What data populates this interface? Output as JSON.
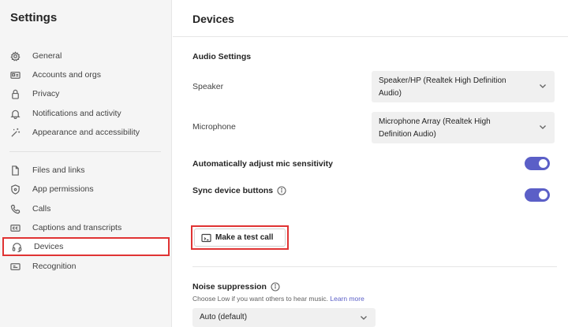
{
  "sidebar": {
    "title": "Settings",
    "items": [
      {
        "label": "General",
        "icon": "gear-icon"
      },
      {
        "label": "Accounts and orgs",
        "icon": "id-card-icon"
      },
      {
        "label": "Privacy",
        "icon": "lock-icon"
      },
      {
        "label": "Notifications and activity",
        "icon": "bell-icon"
      },
      {
        "label": "Appearance and accessibility",
        "icon": "magic-wand-icon"
      },
      {
        "label": "Files and links",
        "icon": "document-icon"
      },
      {
        "label": "App permissions",
        "icon": "shield-icon"
      },
      {
        "label": "Calls",
        "icon": "phone-icon"
      },
      {
        "label": "Captions and transcripts",
        "icon": "closed-captions-icon"
      },
      {
        "label": "Devices",
        "icon": "headset-icon",
        "selected": true
      },
      {
        "label": "Recognition",
        "icon": "recognition-icon"
      }
    ]
  },
  "main": {
    "title": "Devices",
    "audio_section_title": "Audio Settings",
    "speaker": {
      "label": "Speaker",
      "line1": "Speaker/HP (Realtek High Definition",
      "line2": "Audio)"
    },
    "microphone": {
      "label": "Microphone",
      "line1": "Microphone Array (Realtek High",
      "line2": "Definition Audio)"
    },
    "auto_mic": {
      "label": "Automatically adjust mic sensitivity",
      "on": true
    },
    "sync_buttons": {
      "label": "Sync device buttons",
      "on": true
    },
    "test_call_label": "Make a test call",
    "noise": {
      "title": "Noise suppression",
      "hint": "Choose Low if you want others to hear music.",
      "hint_link": "Learn more",
      "value": "Auto (default)"
    }
  },
  "colors": {
    "accent": "#5b5fc7",
    "highlight_box": "#e03333"
  }
}
